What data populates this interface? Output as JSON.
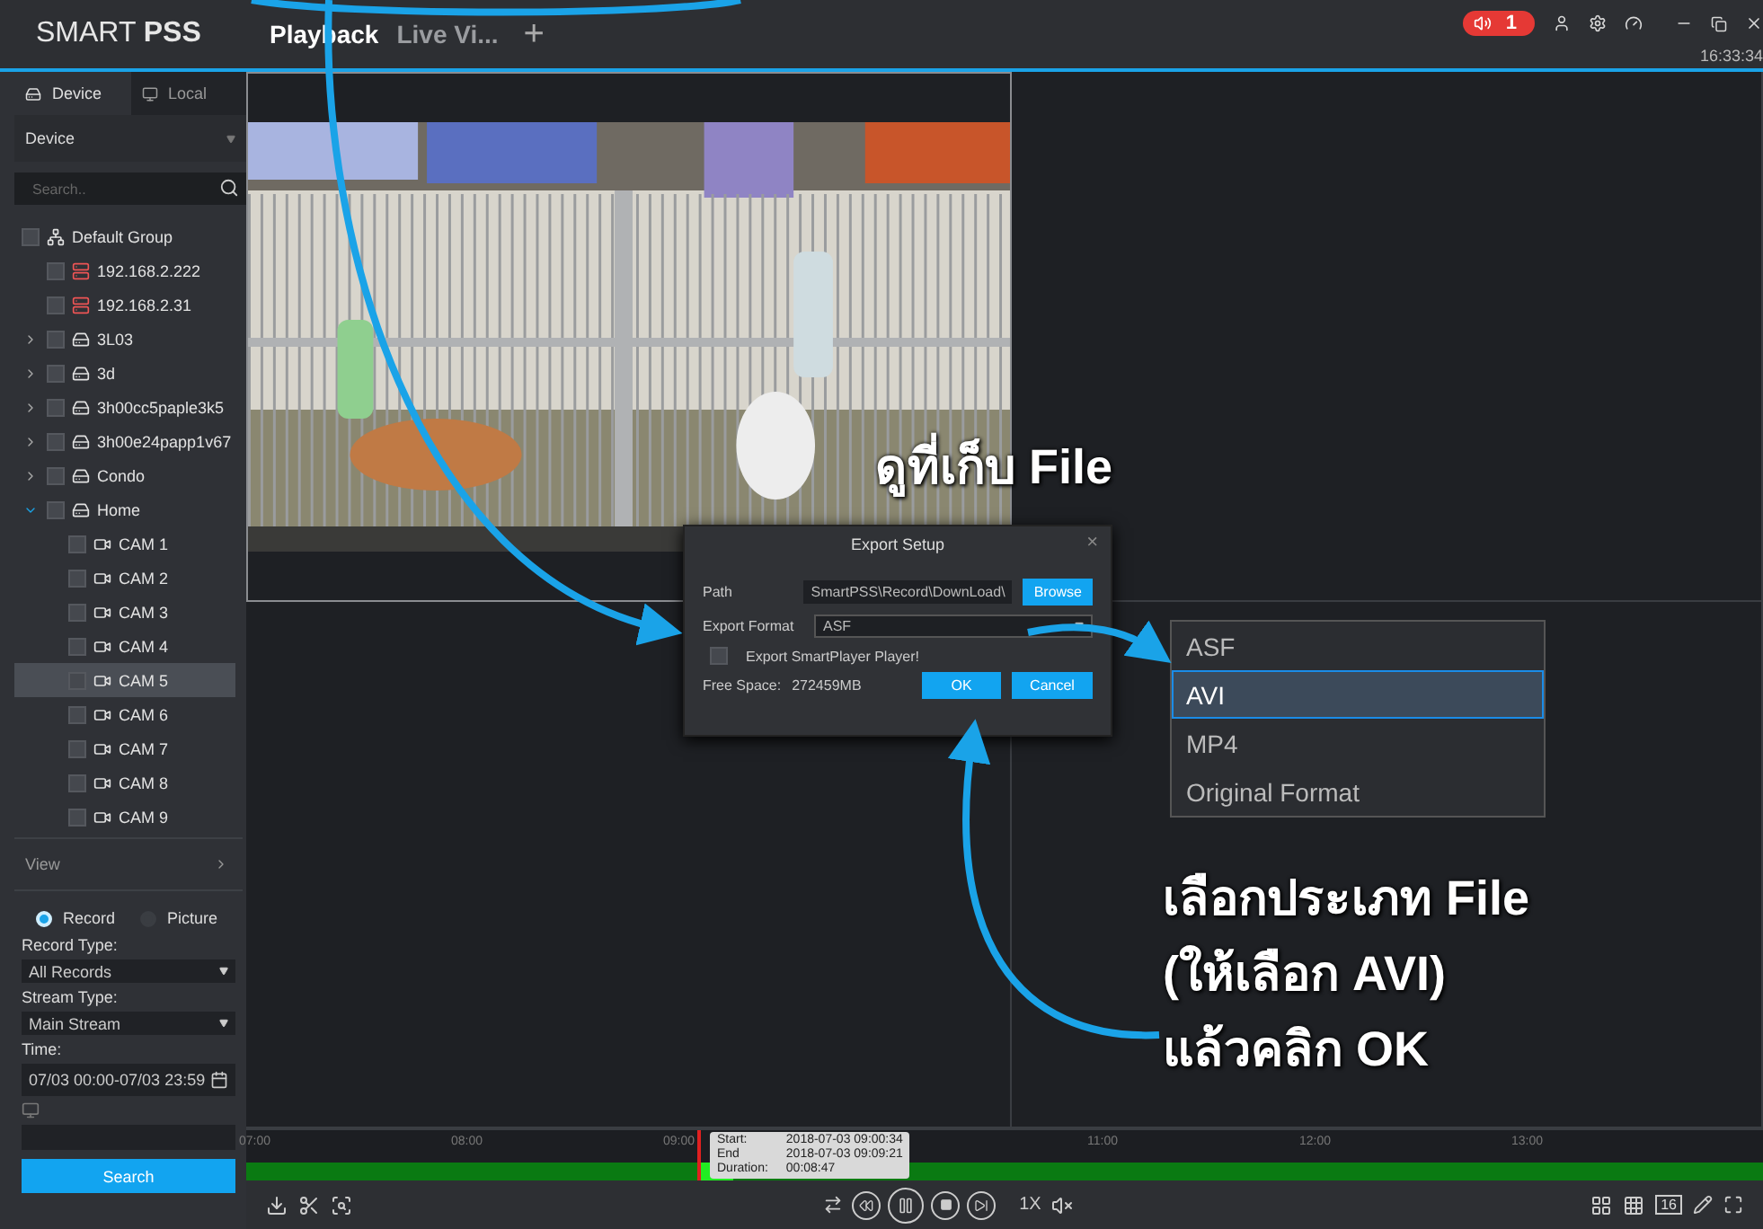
{
  "app": {
    "logo_light": "SMART",
    "logo_bold": "PSS"
  },
  "tabs": [
    {
      "label": "Playback",
      "selected": true
    },
    {
      "label": "Live Vi...",
      "selected": false
    }
  ],
  "add_tab": "+",
  "alarm": {
    "count": "1"
  },
  "clock": "16:33:34",
  "sidebar": {
    "tabs": [
      {
        "label": "Device",
        "selected": true
      },
      {
        "label": "Local",
        "selected": false
      }
    ],
    "device_select": "Device",
    "search": {
      "placeholder": "Search.."
    },
    "tree": [
      {
        "label": "Default Group",
        "kind": "group",
        "checked": false,
        "selected": false,
        "children": [
          {
            "label": "192.168.2.222",
            "kind": "offline",
            "checked": false,
            "selected": false
          },
          {
            "label": "192.168.2.31",
            "kind": "offline",
            "checked": false,
            "selected": false
          },
          {
            "label": "3L03",
            "kind": "dvr",
            "checked": false,
            "selected": false,
            "expanded": false
          },
          {
            "label": "3d",
            "kind": "dvr",
            "checked": false,
            "selected": false,
            "expanded": false
          },
          {
            "label": "3h00cc5paple3k5",
            "kind": "nvr",
            "checked": false,
            "selected": false,
            "expanded": false
          },
          {
            "label": "3h00e24papp1v67",
            "kind": "nvr",
            "checked": false,
            "selected": false,
            "expanded": false
          },
          {
            "label": "Condo",
            "kind": "nvr",
            "checked": false,
            "selected": false,
            "expanded": false
          },
          {
            "label": "Home",
            "kind": "nvr",
            "checked": false,
            "selected": false,
            "expanded": true,
            "children": [
              {
                "label": "CAM 1",
                "kind": "camera",
                "checked": false,
                "selected": false
              },
              {
                "label": "CAM 2",
                "kind": "camera",
                "checked": false,
                "selected": false
              },
              {
                "label": "CAM 3",
                "kind": "camera",
                "checked": false,
                "selected": false
              },
              {
                "label": "CAM 4",
                "kind": "camera",
                "checked": false,
                "selected": false
              },
              {
                "label": "CAM 5",
                "kind": "camera",
                "checked": false,
                "selected": true
              },
              {
                "label": "CAM 6",
                "kind": "camera",
                "checked": false,
                "selected": false
              },
              {
                "label": "CAM 7",
                "kind": "camera",
                "checked": false,
                "selected": false
              },
              {
                "label": "CAM 8",
                "kind": "camera",
                "checked": false,
                "selected": false
              },
              {
                "label": "CAM 9",
                "kind": "camera",
                "checked": false,
                "selected": false
              }
            ]
          }
        ]
      }
    ],
    "view": "View",
    "mode": [
      {
        "label": "Record",
        "selected": true
      },
      {
        "label": "Picture",
        "selected": false
      }
    ],
    "record_type": {
      "label": "Record Type:",
      "value": "All Records"
    },
    "stream_type": {
      "label": "Stream Type:",
      "value": "Main Stream"
    },
    "time": {
      "label": "Time:",
      "value": "07/03 00:00-07/03 23:59"
    },
    "search_button": "Search"
  },
  "timeline": {
    "labels": [
      "07:00",
      "08:00",
      "09:00",
      "11:00",
      "12:00",
      "13:00"
    ],
    "tooltip": [
      {
        "label": "Start:",
        "value": "2018-07-03 09:00:34"
      },
      {
        "label": "End",
        "value": "2018-07-03 09:09:21"
      },
      {
        "label": "Duration:",
        "value": "00:08:47"
      }
    ]
  },
  "controls": {
    "speed": "1X",
    "layout_count": "16"
  },
  "dialog": {
    "title": "Export Setup",
    "close": "×",
    "path": {
      "label": "Path",
      "value": "SmartPSS\\Record\\DownLoad\\"
    },
    "browse": "Browse",
    "format": {
      "label": "Export Format",
      "value": "ASF"
    },
    "export_player": {
      "label": "Export SmartPlayer Player!",
      "checked": false
    },
    "free_space": {
      "label": "Free Space:",
      "value": "272459MB"
    },
    "buttons": [
      "OK",
      "Cancel"
    ]
  },
  "format_menu": [
    {
      "label": "ASF",
      "selected": false
    },
    {
      "label": "AVI",
      "selected": true
    },
    {
      "label": "MP4",
      "selected": false
    },
    {
      "label": "Original Format",
      "selected": false
    }
  ],
  "annotations": [
    {
      "text": "ดูที่เก็บ File"
    },
    {
      "text": "เลือกประเภท File"
    },
    {
      "text": "(ให้เลือก AVI)"
    },
    {
      "text": "แล้วคลิก OK"
    }
  ]
}
